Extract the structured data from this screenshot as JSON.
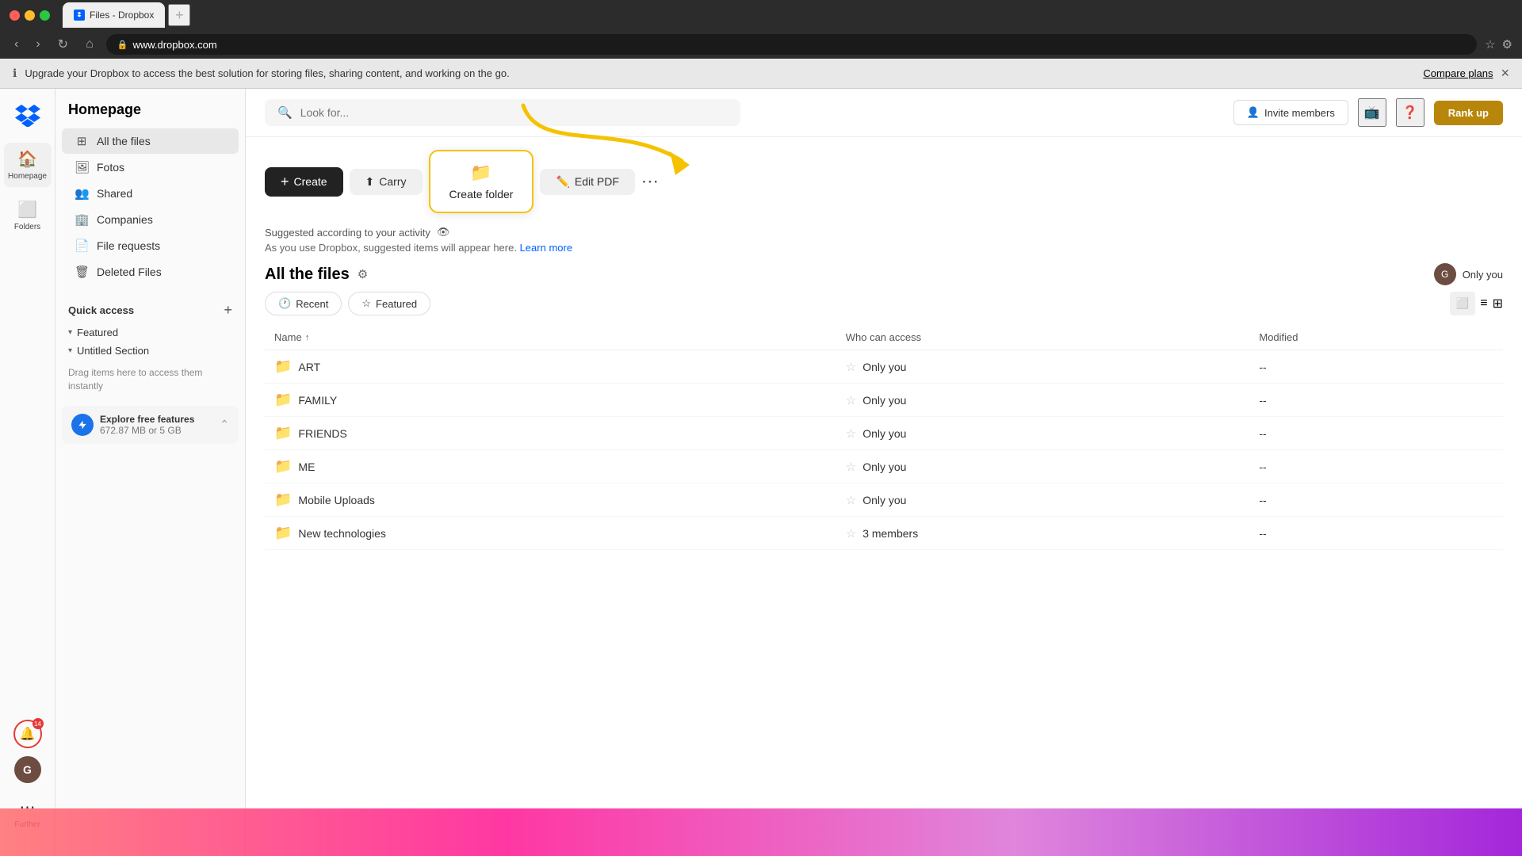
{
  "browser": {
    "title": "Files - Dropbox",
    "url": "www.dropbox.com",
    "new_tab_label": "+"
  },
  "notification_bar": {
    "text": "Upgrade your Dropbox to access the best solution for storing files, sharing content, and working on the go.",
    "link_text": "Compare plans",
    "close_label": "×"
  },
  "left_nav": {
    "logo_label": "Dropbox",
    "items": [
      {
        "id": "home",
        "label": "Homepage",
        "icon": "🏠",
        "active": true
      },
      {
        "id": "folders",
        "label": "Folders",
        "icon": "📁",
        "active": false
      },
      {
        "id": "further",
        "label": "Further",
        "icon": "⋯",
        "active": false
      }
    ]
  },
  "sidebar": {
    "title": "Homepage",
    "nav_items": [
      {
        "id": "all-files",
        "label": "All the files",
        "icon": "⊞",
        "active": true
      },
      {
        "id": "fotos",
        "label": "Fotos",
        "icon": "🖼"
      },
      {
        "id": "shared",
        "label": "Shared",
        "icon": "👥"
      },
      {
        "id": "companies",
        "label": "Companies",
        "icon": "🏢"
      },
      {
        "id": "file-requests",
        "label": "File requests",
        "icon": "📄"
      },
      {
        "id": "deleted-files",
        "label": "Deleted Files",
        "icon": "🗑"
      }
    ],
    "quick_access": {
      "label": "Quick access",
      "add_label": "+"
    },
    "featured": {
      "label": "Featured"
    },
    "untitled_section": {
      "label": "Untitled Section"
    },
    "drag_hint": "Drag items here to access them instantly",
    "explore": {
      "title": "Explore free features",
      "subtitle": "672.87 MB or 5 GB"
    }
  },
  "header": {
    "search_placeholder": "Look for...",
    "invite_label": "Invite members",
    "rank_label": "Rank up"
  },
  "toolbar": {
    "create_label": "Create",
    "carry_label": "Carry",
    "create_folder_label": "Create folder",
    "edit_pdf_label": "Edit PDF"
  },
  "suggested": {
    "header": "Suggested according to your activity",
    "body": "As you use Dropbox, suggested items will appear here.",
    "learn_more": "Learn more"
  },
  "files_section": {
    "title": "All the files",
    "columns": {
      "name": "Name",
      "access": "Who can access",
      "modified": "Modified"
    },
    "filter_tabs": [
      {
        "id": "recent",
        "label": "Recent",
        "icon": "🕐"
      },
      {
        "id": "featured",
        "label": "Featured",
        "icon": "☆"
      }
    ],
    "rows": [
      {
        "name": "ART",
        "type": "folder",
        "access": "Only you",
        "modified": "--"
      },
      {
        "name": "FAMILY",
        "type": "folder",
        "access": "Only you",
        "modified": "--"
      },
      {
        "name": "FRIENDS",
        "type": "folder",
        "access": "Only you",
        "modified": "--"
      },
      {
        "name": "ME",
        "type": "folder",
        "access": "Only you",
        "modified": "--"
      },
      {
        "name": "Mobile Uploads",
        "type": "folder",
        "access": "Only you",
        "modified": "--"
      },
      {
        "name": "New technologies",
        "type": "folder",
        "access": "3 members",
        "modified": "--"
      }
    ]
  }
}
